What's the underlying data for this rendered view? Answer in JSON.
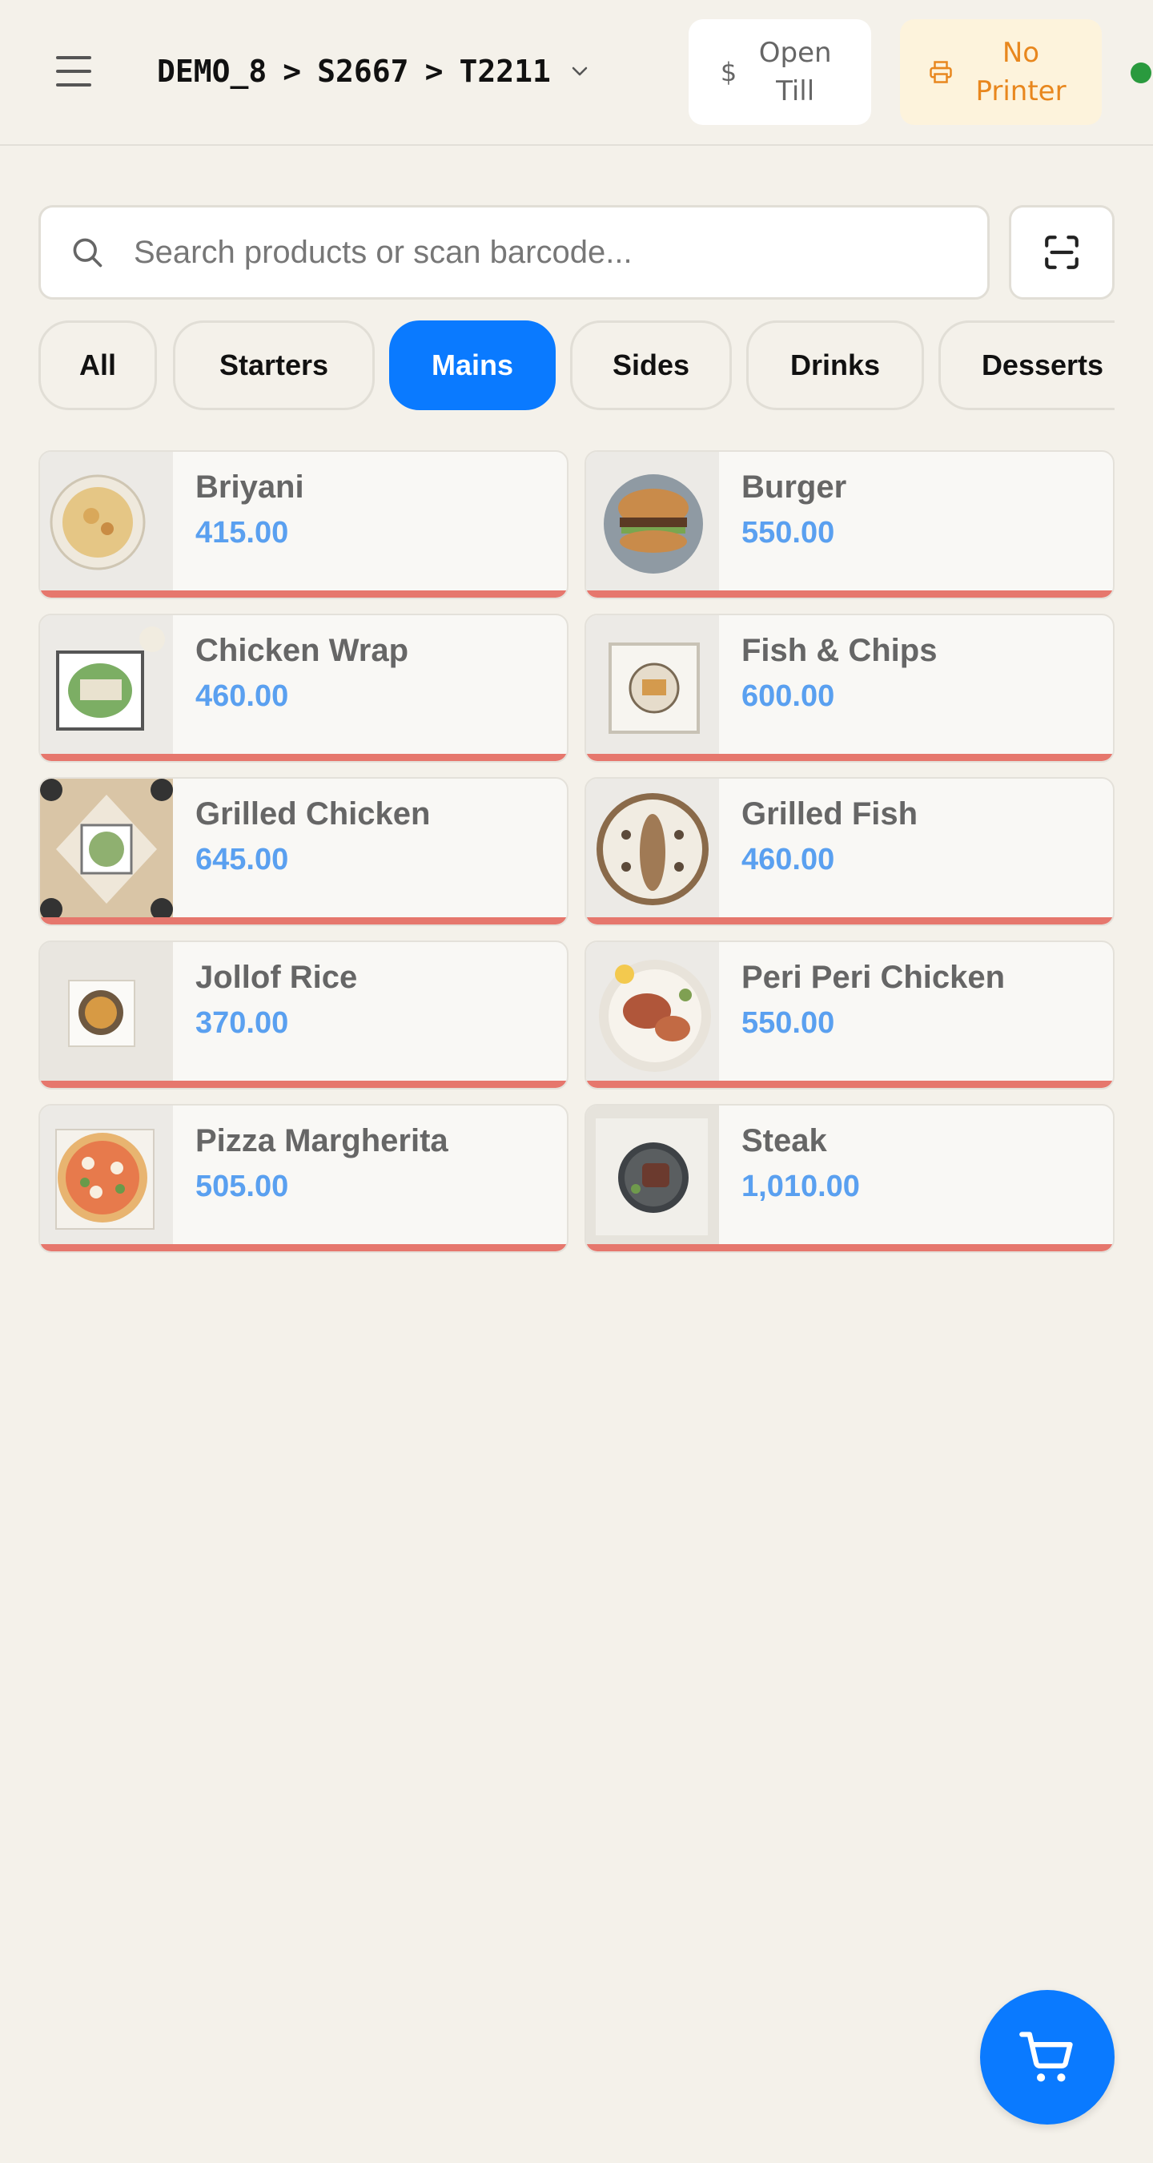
{
  "header": {
    "breadcrumb": [
      "DEMO_8",
      "S2667",
      "T2211"
    ],
    "breadcrumb_sep": ">",
    "open_till": {
      "symbol": "$",
      "line1": "Open",
      "line2": "Till"
    },
    "no_printer": {
      "line1": "No",
      "line2": "Printer"
    },
    "status_color": "#2a9a3e"
  },
  "search": {
    "placeholder": "Search products or scan barcode..."
  },
  "tabs": [
    {
      "label": "All",
      "active": false
    },
    {
      "label": "Starters",
      "active": false
    },
    {
      "label": "Mains",
      "active": true
    },
    {
      "label": "Sides",
      "active": false
    },
    {
      "label": "Drinks",
      "active": false
    },
    {
      "label": "Desserts",
      "active": false
    }
  ],
  "products": [
    {
      "name": "Briyani",
      "price": "415.00",
      "image": "rice-dish"
    },
    {
      "name": "Burger",
      "price": "550.00",
      "image": "burger"
    },
    {
      "name": "Chicken Wrap",
      "price": "460.00",
      "image": "wrap"
    },
    {
      "name": "Fish & Chips",
      "price": "600.00",
      "image": "fish-chips"
    },
    {
      "name": "Grilled Chicken",
      "price": "645.00",
      "image": "salad-plate"
    },
    {
      "name": "Grilled Fish",
      "price": "460.00",
      "image": "fish-plate"
    },
    {
      "name": "Jollof Rice",
      "price": "370.00",
      "image": "rice-bowl"
    },
    {
      "name": "Peri Peri Chicken",
      "price": "550.00",
      "image": "chicken-plate"
    },
    {
      "name": "Pizza Margherita",
      "price": "505.00",
      "image": "pizza"
    },
    {
      "name": "Steak",
      "price": "1,010.00",
      "image": "steak"
    }
  ],
  "colors": {
    "accent": "#0a7aff",
    "price": "#5aa0f0",
    "card_bar": "#e6776d",
    "printer_warning": "#e8871e"
  }
}
